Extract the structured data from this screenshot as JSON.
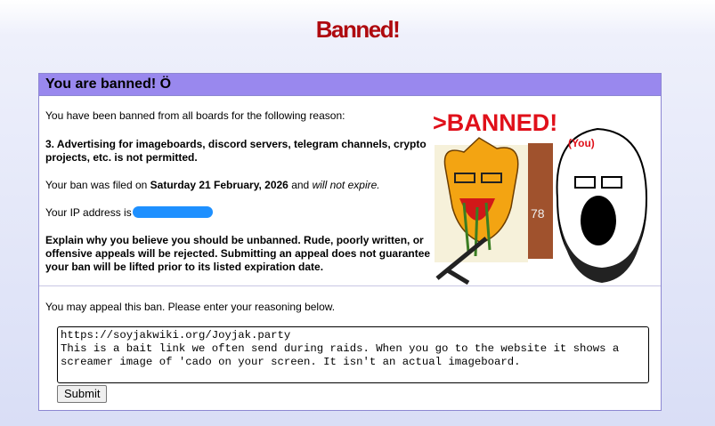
{
  "page_title": "Banned!",
  "box": {
    "header": "You are banned! Ö",
    "intro": "You have been banned from all boards for the following reason:",
    "reason": "3. Advertising for imageboards, discord servers, telegram channels, crypto projects, etc. is not permitted.",
    "filed_prefix": "Your ban was filed on",
    "filed_date": "Saturday 21 February, 2026",
    "filed_and": "and",
    "filed_expiry": "will not expire.",
    "ip_label": "Your IP address is",
    "explain": "Explain why you believe you should be unbanned. Rude, poorly written, or offensive appeals will be rejected. Submitting an appeal does not guarantee your ban will be lifted prior to its listed expiration date.",
    "banner": {
      "headline": ">BANNED!",
      "you_label": "(You)",
      "number": "78"
    },
    "appeal_prompt": "You may appeal this ban. Please enter your reasoning below.",
    "appeal_text": "https://soyjakwiki.org/Joyjak.party\nThis is a bait link we often send during raids. When you go to the website it shows a screamer image of 'cado on your screen. It isn't an actual imageboard.",
    "submit_label": "Submit"
  },
  "colors": {
    "title": "#af0a0f",
    "header_bg": "#9988ee",
    "border": "#8d87d2",
    "ip_mask": "#1e90ff"
  }
}
